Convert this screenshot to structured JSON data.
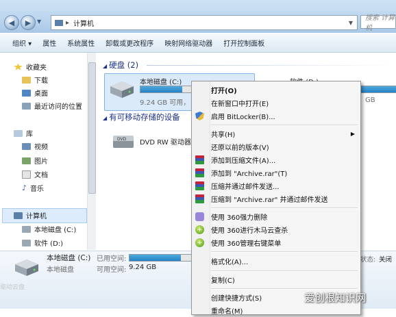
{
  "address": {
    "location": "计算机",
    "search_placeholder": "搜索 计算机"
  },
  "toolbar": {
    "organize": "组织 ▾",
    "properties": "属性",
    "system_properties": "系统属性",
    "uninstall": "卸载或更改程序",
    "map_drive": "映射网络驱动器",
    "control_panel": "打开控制面板"
  },
  "nav": {
    "favorites": "收藏夹",
    "downloads": "下载",
    "desktop": "桌面",
    "recent": "最近访问的位置",
    "libraries": "库",
    "videos": "视频",
    "pictures": "图片",
    "documents": "文档",
    "music": "音乐",
    "computer": "计算机",
    "local_disk_c": "本地磁盘 (C:)",
    "soft_d": "软件 (D:)"
  },
  "content": {
    "hard_disks_header": "硬盘 (2)",
    "drive_c_name": "本地磁盘 (C:)",
    "drive_c_free": "9.24 GB 可用，",
    "drive_c_used_fraction": 0.83,
    "drive_d_name": "软件 (D:)",
    "drive_d_free": "GB",
    "removable_header": "有可移动存储的设备",
    "dvd_name": "DVD RW 驱动器"
  },
  "details": {
    "name": "本地磁盘 (C:)",
    "used_label": "已用空间:",
    "type": "本地磁盘",
    "free_label": "可用空间:",
    "free_value": "9.24 GB",
    "status_label": "状态:",
    "status_value": "关闭",
    "used_fraction": 0.83
  },
  "context_menu": {
    "open": "打开(O)",
    "open_new_window": "在新窗口中打开(E)",
    "bitlocker": "启用 BitLocker(B)...",
    "share": "共享(H)",
    "restore": "还原以前的版本(V)",
    "add_archive": "添加到压缩文件(A)...",
    "add_rar": "添加到 \"Archive.rar\"(T)",
    "compress_email": "压缩并通过邮件发送...",
    "compress_rar_email": "压缩到 \"Archive.rar\" 并通过邮件发送",
    "force_delete": "使用 360强力删除",
    "trojan_scan": "使用 360进行木马云查杀",
    "manage_menu": "使用 360管理右键菜单",
    "format": "格式化(A)...",
    "copy": "复制(C)",
    "create_shortcut": "创建快捷方式(S)",
    "rename": "重命名(M)"
  },
  "bottom_left_text": "驱动云盘",
  "watermark": "爱创根知识网",
  "colors": {
    "accent": "#2682c6",
    "selection": "#dbeaf9",
    "header_text": "#1e3287"
  }
}
